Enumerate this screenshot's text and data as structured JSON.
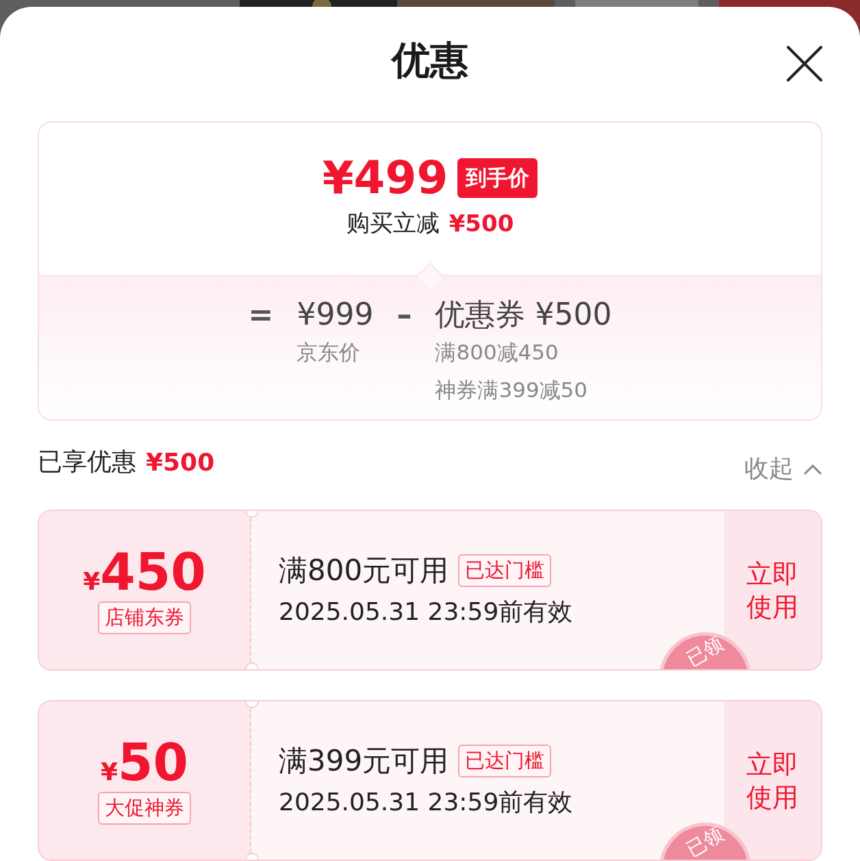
{
  "header": {
    "title": "优惠"
  },
  "summary": {
    "final_price": "¥499",
    "final_label": "到手价",
    "reduction_label": "购买立减",
    "reduction": "¥500",
    "equals": "=",
    "list_price": "¥999",
    "list_price_label": "京东价",
    "minus": "–",
    "coupon_label": "优惠券",
    "coupon_total": "¥500",
    "details": [
      "满800减450",
      "神券满399减50"
    ]
  },
  "saved": {
    "label": "已享优惠",
    "amount": "¥500",
    "toggle": "收起",
    "expanded": true
  },
  "coupons": [
    {
      "currency": "¥",
      "amount": "450",
      "type": "店铺东券",
      "condition": "满800元可用",
      "status": "已达门槛",
      "validity": "2025.05.31 23:59前有效",
      "action": "立即使用",
      "stamp": "已领"
    },
    {
      "currency": "¥",
      "amount": "50",
      "type": "大促神券",
      "condition": "满399元可用",
      "status": "已达门槛",
      "validity": "2025.05.31 23:59前有效",
      "action": "立即使用",
      "stamp": "已领"
    }
  ]
}
